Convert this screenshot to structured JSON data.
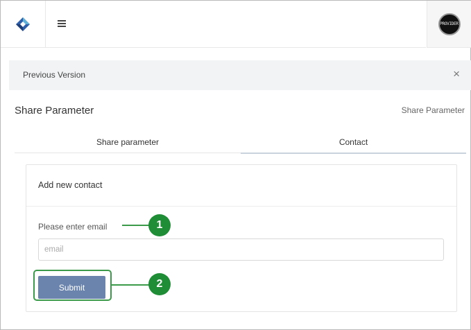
{
  "header": {
    "logo_icon": "diamond-logo-icon",
    "menu_icon": "hamburger-icon",
    "avatar_text": "PROVIDER"
  },
  "notice": {
    "label": "Previous Version",
    "close_glyph": "×"
  },
  "page": {
    "title": "Share Parameter",
    "breadcrumb": "Share Parameter"
  },
  "tabs": [
    {
      "label": "Share parameter",
      "active": false
    },
    {
      "label": "Contact",
      "active": true
    }
  ],
  "form": {
    "title": "Add new contact",
    "email_label": "Please enter email",
    "email_placeholder": "email",
    "email_value": "",
    "submit_label": "Submit"
  },
  "callouts": [
    "1",
    "2"
  ],
  "colors": {
    "accent": "#6b84ad",
    "callout": "#1f8c36",
    "notice_bg": "#f1f3f5"
  }
}
